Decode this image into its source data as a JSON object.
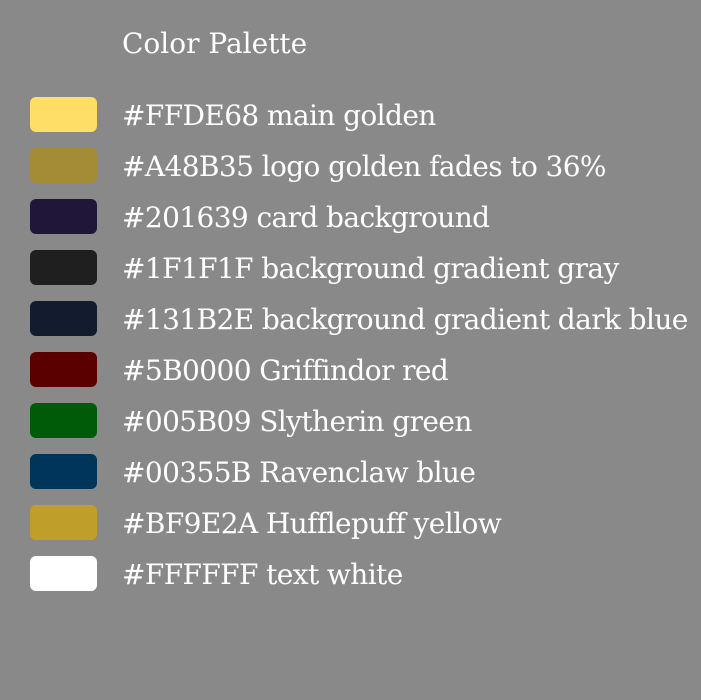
{
  "title": "Color Palette",
  "colors": [
    {
      "hex": "#FFDE68",
      "label": "#FFDE68 main golden"
    },
    {
      "hex": "#A48B35",
      "label": "#A48B35 logo golden fades to 36%"
    },
    {
      "hex": "#201639",
      "label": "#201639 card background"
    },
    {
      "hex": "#1F1F1F",
      "label": "#1F1F1F background gradient gray"
    },
    {
      "hex": "#131B2E",
      "label": "#131B2E background gradient dark blue"
    },
    {
      "hex": "#5B0000",
      "label": "#5B0000 Griffindor red"
    },
    {
      "hex": "#005B09",
      "label": "#005B09 Slytherin green"
    },
    {
      "hex": "#00355B",
      "label": "#00355B Ravenclaw blue"
    },
    {
      "hex": "#BF9E2A",
      "label": "#BF9E2A Hufflepuff yellow"
    },
    {
      "hex": "#FFFFFF",
      "label": "#FFFFFF text white"
    }
  ],
  "background": "#898989",
  "text_color": "#FFFFFF"
}
